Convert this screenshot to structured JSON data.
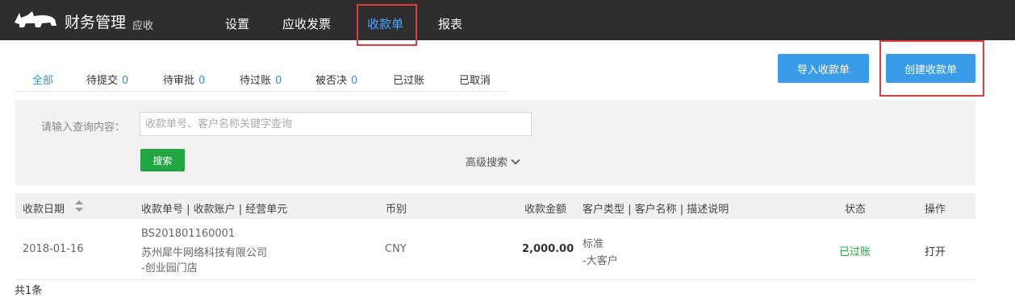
{
  "header": {
    "title": "财务管理",
    "subtitle": "应收",
    "nav": [
      {
        "label": "设置"
      },
      {
        "label": "应收发票"
      },
      {
        "label": "收款单"
      },
      {
        "label": "报表"
      }
    ]
  },
  "tabs": [
    {
      "label": "全部",
      "count": ""
    },
    {
      "label": "待提交",
      "count": "0"
    },
    {
      "label": "待审批",
      "count": "0"
    },
    {
      "label": "待过账",
      "count": "0"
    },
    {
      "label": "被否决",
      "count": "0"
    },
    {
      "label": "已过账",
      "count": ""
    },
    {
      "label": "已取消",
      "count": ""
    }
  ],
  "actions": {
    "import_label": "导入收款单",
    "create_label": "创建收款单"
  },
  "search": {
    "label": "请输入查询内容：",
    "placeholder": "收款单号、客户名称关键字查询",
    "button_label": "搜索",
    "advanced_label": "高级搜索"
  },
  "table": {
    "headers": {
      "date": "收款日期",
      "doc": "收款单号 | 收款账户 | 经营单元",
      "currency": "币别",
      "amount": "收款金额",
      "customer": "客户类型 | 客户名称 | 描述说明",
      "status": "状态",
      "ops": "操作"
    },
    "rows": [
      {
        "date": "2018-01-16",
        "doc_no": "BS201801160001",
        "account": "苏州犀牛网络科技有限公司",
        "unit": "-创业园门店",
        "currency": "CNY",
        "amount": "2,000.00",
        "customer_type": "标准",
        "customer_name": "-大客户",
        "status": "已过账",
        "op": "打开"
      }
    ]
  },
  "footer": {
    "total_text": "共1条"
  },
  "colors": {
    "topbar": "#2e2e2e",
    "accent": "#3b8fd9",
    "button": "#3a9be8",
    "search_button": "#22a641",
    "status_posted": "#22a641",
    "highlight_border": "#e23b3b"
  }
}
